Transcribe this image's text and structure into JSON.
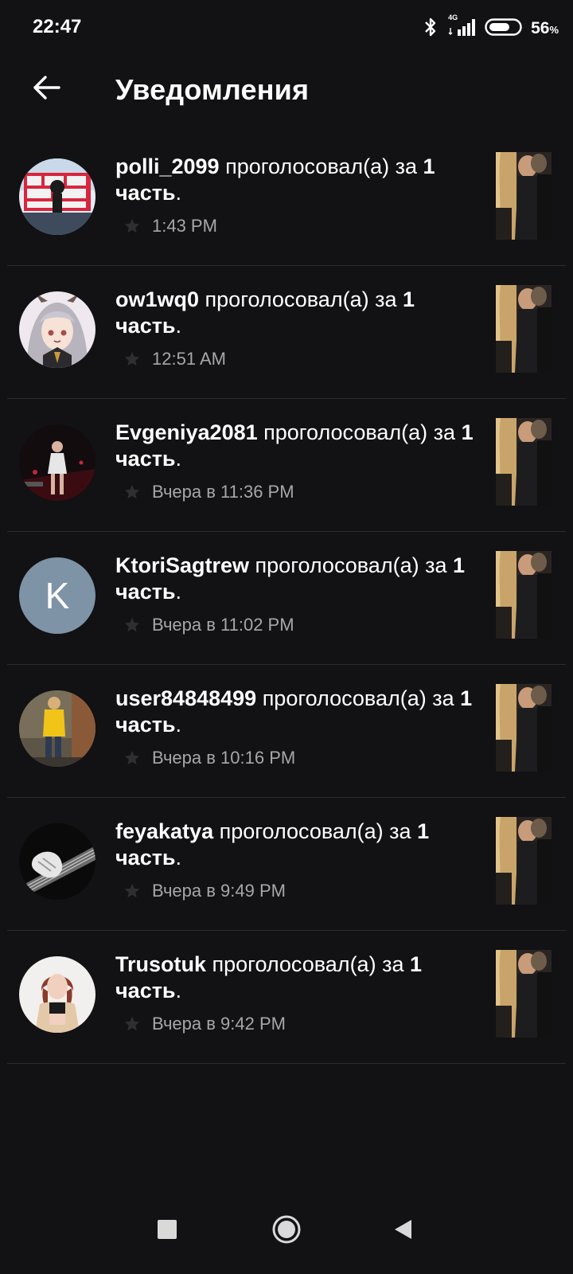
{
  "status_bar": {
    "time": "22:47",
    "network": "4G",
    "battery_percent": "56",
    "battery_unit": "%"
  },
  "header": {
    "title": "Уведомления",
    "back_icon": "arrow-left-icon"
  },
  "notifications": [
    {
      "user": "polli_2099",
      "action": "проголосовал(а) за",
      "part_number": "1",
      "part_word": "часть",
      "time": "1:43 PM",
      "avatar_type": "photo-red-sign"
    },
    {
      "user": "ow1wq0",
      "action": "проголосовал(а) за",
      "part_number": "1",
      "part_word": "часть",
      "time": "12:51 AM",
      "avatar_type": "photo-anime"
    },
    {
      "user": "Evgeniya2081",
      "action": "проголосовал(а) за",
      "part_number": "1",
      "part_word": "часть",
      "time": "Вчера в 11:36 PM",
      "avatar_type": "photo-dancer"
    },
    {
      "user": "KtoriSagtrew",
      "action": "проголосовал(а) за",
      "part_number": "1",
      "part_word": "часть",
      "time": "Вчера в 11:02 PM",
      "avatar_type": "letter",
      "avatar_letter": "K",
      "avatar_color": "#7e93a6"
    },
    {
      "user": "user84848499",
      "action": "проголосовал(а) за",
      "part_number": "1",
      "part_word": "часть",
      "time": "Вчера в 10:16 PM",
      "avatar_type": "photo-yellow"
    },
    {
      "user": "feyakatya",
      "action": "проголосовал(а) за",
      "part_number": "1",
      "part_word": "часть",
      "time": "Вчера в 9:49 PM",
      "avatar_type": "photo-guitar"
    },
    {
      "user": "Trusotuk",
      "action": "проголосовал(а) за",
      "part_number": "1",
      "part_word": "часть",
      "time": "Вчера в 9:42 PM",
      "avatar_type": "photo-girl"
    }
  ],
  "nav_bar": {
    "buttons": [
      "recents-square-icon",
      "home-circle-icon",
      "back-triangle-icon"
    ]
  },
  "colors": {
    "background": "#121114",
    "divider": "#2c2b2f",
    "secondary_text": "#a7a6aa"
  }
}
